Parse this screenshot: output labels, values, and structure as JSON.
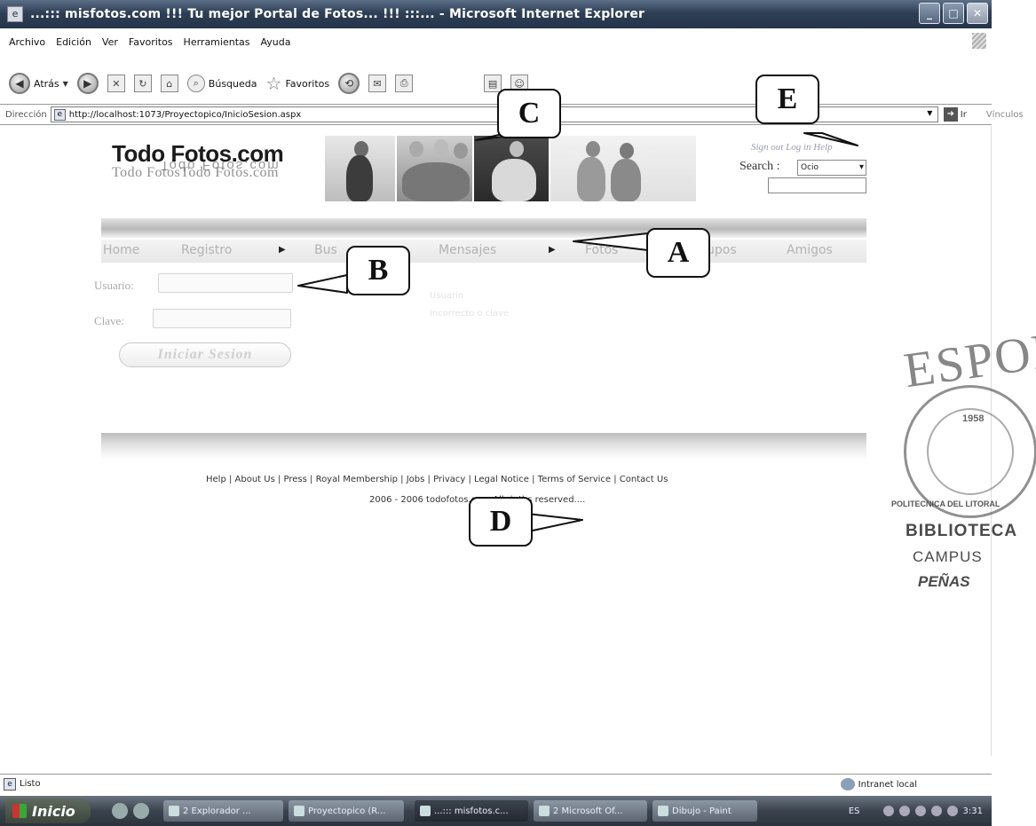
{
  "window": {
    "title": "...::: misfotos.com !!! Tu mejor Portal de Fotos... !!! :::... - Microsoft Internet Explorer",
    "app_icon": "ie-page-icon",
    "buttons": [
      "minimize",
      "maximize",
      "close"
    ]
  },
  "menu": {
    "items": [
      "Archivo",
      "Edición",
      "Ver",
      "Favoritos",
      "Herramientas",
      "Ayuda"
    ]
  },
  "toolbar": {
    "back_label": "Atrás",
    "search_label": "Búsqueda",
    "favorites_label": "Favoritos",
    "icons": [
      "back-icon",
      "forward-icon",
      "stop-icon",
      "refresh-icon",
      "home-icon",
      "search-icon",
      "favorites-icon",
      "history-icon",
      "mail-icon",
      "print-icon",
      "research-icon",
      "messenger-icon"
    ]
  },
  "address": {
    "label": "Dirección",
    "url": "http://localhost:1073/Proyectopico/InicioSesion.aspx",
    "go_label": "Ir",
    "links_label": "Vínculos"
  },
  "page": {
    "logo": {
      "text": "Todo Fotos.com",
      "echo_text": "Todo FotosTodo Fotos.com",
      "mirror_text": "Todo Fotos.com"
    },
    "header": {
      "signin_link": "Sign out Log in Help",
      "search_label": "Search :",
      "search_selected": "Ocio",
      "search_value": ""
    },
    "nav": {
      "items": [
        "Home",
        "Registro",
        "Bus",
        "Mensajes",
        "Fotos",
        "upos",
        "Amigos"
      ]
    },
    "login": {
      "user_label": "Usuario:",
      "user_value": "",
      "pass_label": "Clave:",
      "pass_value": "",
      "submit_label": "Iniciar Sesion",
      "faint_line_1": "Usuario",
      "faint_line_2": "incorrecto o clave"
    },
    "footer": {
      "links": "Help | About Us | Press | Royal Membership | Jobs | Privacy | Legal Notice | Terms of Service | Contact Us",
      "copyright": "2006 - 2006 todofotos.com All rigths reserved...."
    }
  },
  "callouts": [
    "A",
    "B",
    "C",
    "D",
    "E"
  ],
  "statusbar": {
    "status": "Listo",
    "zone": "Intranet local"
  },
  "taskbar": {
    "start_label": "Inicio",
    "tasks": [
      "2 Explorador ...",
      "Proyectopico (R...",
      "...::: misfotos.c...",
      "2 Microsoft Of...",
      "Dibujo - Paint"
    ],
    "language": "ES",
    "clock": "3:31"
  },
  "stamp": {
    "top": "ESPOL",
    "year": "1958",
    "ring_text": "POLITECNICA DEL LITORAL",
    "line1": "BIBLIOTECA",
    "line2": "CAMPUS",
    "line3": "PEÑAS"
  }
}
